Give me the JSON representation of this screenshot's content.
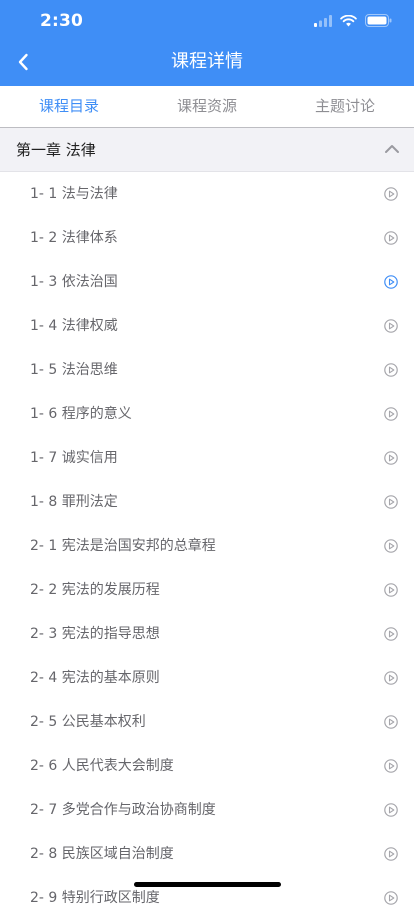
{
  "status_bar": {
    "time": "2:30"
  },
  "nav": {
    "title": "课程详情"
  },
  "tabs": [
    {
      "label": "课程目录",
      "active": true
    },
    {
      "label": "课程资源",
      "active": false
    },
    {
      "label": "主题讨论",
      "active": false
    }
  ],
  "chapter": {
    "title": "第一章 法律"
  },
  "lessons": [
    {
      "label": "1- 1 法与法律",
      "playing": false
    },
    {
      "label": "1- 2 法律体系",
      "playing": false
    },
    {
      "label": "1- 3 依法治国",
      "playing": true
    },
    {
      "label": "1- 4 法律权威",
      "playing": false
    },
    {
      "label": "1- 5 法治思维",
      "playing": false
    },
    {
      "label": "1- 6 程序的意义",
      "playing": false
    },
    {
      "label": "1- 7 诚实信用",
      "playing": false
    },
    {
      "label": "1- 8 罪刑法定",
      "playing": false
    },
    {
      "label": "2- 1 宪法是治国安邦的总章程",
      "playing": false
    },
    {
      "label": "2- 2 宪法的发展历程",
      "playing": false
    },
    {
      "label": "2- 3 宪法的指导思想",
      "playing": false
    },
    {
      "label": "2- 4 宪法的基本原则",
      "playing": false
    },
    {
      "label": "2- 5 公民基本权利",
      "playing": false
    },
    {
      "label": "2- 6 人民代表大会制度",
      "playing": false
    },
    {
      "label": "2- 7 多党合作与政治协商制度",
      "playing": false
    },
    {
      "label": "2- 8 民族区域自治制度",
      "playing": false
    },
    {
      "label": "2- 9 特别行政区制度",
      "playing": false
    }
  ],
  "colors": {
    "accent": "#3f8ef6",
    "icon_inactive": "#a6a6ab",
    "icon_active": "#3f8ef6"
  },
  "icons": {
    "back": "chevron-left-icon",
    "collapse": "chevron-up-icon",
    "play": "play-circle-icon"
  }
}
